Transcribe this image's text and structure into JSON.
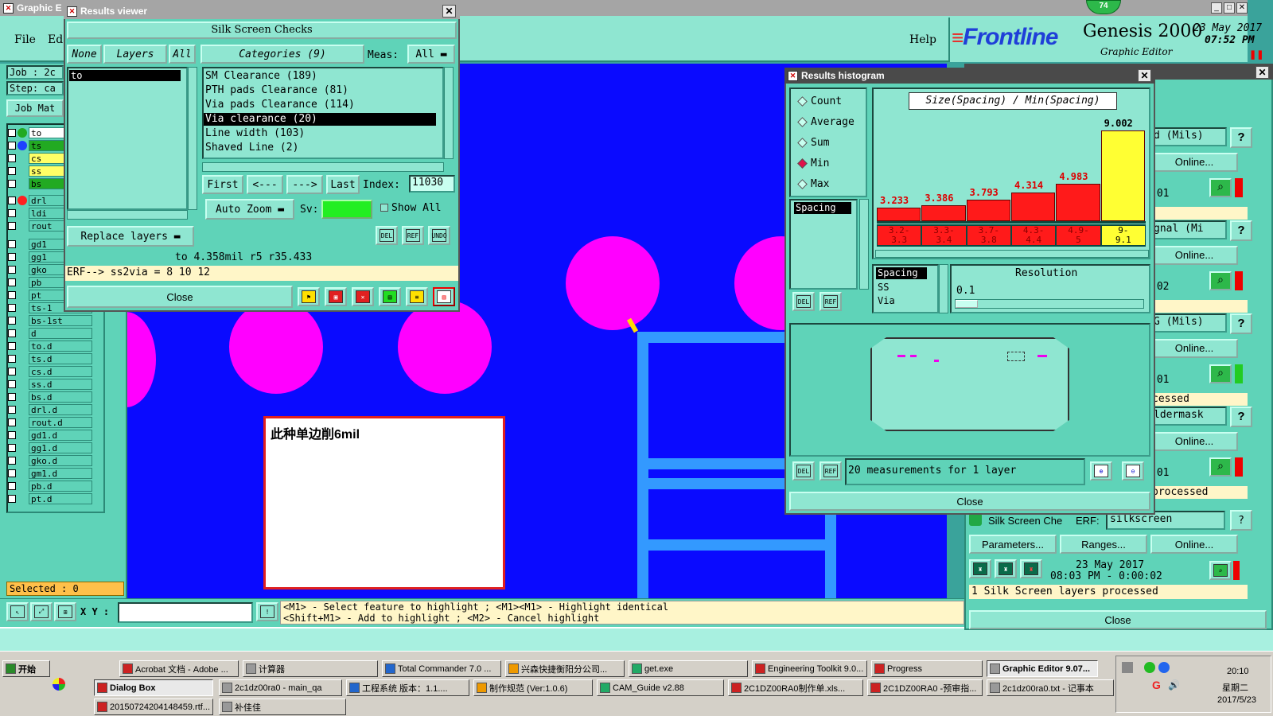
{
  "main_window": {
    "title": "Graphic E",
    "menu": {
      "file": "File",
      "edit": "Ed",
      "help": "Help"
    },
    "brand": {
      "logo": "Frontline",
      "product": "Genesis 2000",
      "subtitle": "Graphic Editor",
      "date": "23 May 2017",
      "time": "07:52 PM"
    },
    "badge": "74",
    "job_label": "Job : 2c",
    "step_label": "Step: ca",
    "job_matrix": "Job Mat",
    "selected": "Selected : 0",
    "coord_label": "X Y :",
    "status_line1": "<M1> - Select feature to highlight ; <M1><M1> - Highlight identical",
    "status_line2": "<Shift+M1> - Add to highlight ; <M2> - Cancel highlight"
  },
  "layers": [
    {
      "name": "to",
      "color": "#2f4fff",
      "dot": "#22aa22",
      "bg": "#ffffff"
    },
    {
      "name": "ts",
      "color": "#2f4fff",
      "dot": "#1e40ff",
      "bg": "#22aa22"
    },
    {
      "name": "cs",
      "color": "#ffff66",
      "dot": "",
      "bg": "#ffff66"
    },
    {
      "name": "ss",
      "color": "#ffff66",
      "dot": "",
      "bg": "#ffff66"
    },
    {
      "name": "bs",
      "color": "#22aa22",
      "dot": "",
      "bg": "#22aa22"
    },
    {
      "name": "drl",
      "color": "",
      "dot": "#ff2020",
      "bg": "#5fd3b8"
    },
    {
      "name": "ldi",
      "color": "",
      "dot": "",
      "bg": "#5fd3b8"
    },
    {
      "name": "rout",
      "color": "",
      "dot": "",
      "bg": "#5fd3b8"
    },
    {
      "name": "gd1",
      "color": "",
      "dot": "",
      "bg": "#5fd3b8"
    },
    {
      "name": "gg1",
      "color": "",
      "dot": "",
      "bg": "#5fd3b8"
    },
    {
      "name": "gko",
      "color": "",
      "dot": "",
      "bg": "#5fd3b8"
    },
    {
      "name": "pb",
      "color": "",
      "dot": "",
      "bg": "#5fd3b8"
    },
    {
      "name": "pt",
      "color": "",
      "dot": "",
      "bg": "#5fd3b8"
    },
    {
      "name": "ts-1",
      "color": "",
      "dot": "",
      "bg": "#5fd3b8"
    },
    {
      "name": "bs-1st",
      "color": "",
      "dot": "",
      "bg": "#5fd3b8"
    },
    {
      "name": "d",
      "color": "",
      "dot": "",
      "bg": "#5fd3b8"
    },
    {
      "name": "to.d",
      "color": "",
      "dot": "",
      "bg": "#5fd3b8"
    },
    {
      "name": "ts.d",
      "color": "",
      "dot": "",
      "bg": "#5fd3b8"
    },
    {
      "name": "cs.d",
      "color": "",
      "dot": "",
      "bg": "#5fd3b8"
    },
    {
      "name": "ss.d",
      "color": "",
      "dot": "",
      "bg": "#5fd3b8"
    },
    {
      "name": "bs.d",
      "color": "",
      "dot": "",
      "bg": "#5fd3b8"
    },
    {
      "name": "drl.d",
      "color": "",
      "dot": "",
      "bg": "#5fd3b8"
    },
    {
      "name": "rout.d",
      "color": "",
      "dot": "",
      "bg": "#5fd3b8"
    },
    {
      "name": "gd1.d",
      "color": "",
      "dot": "",
      "bg": "#5fd3b8"
    },
    {
      "name": "gg1.d",
      "color": "",
      "dot": "",
      "bg": "#5fd3b8"
    },
    {
      "name": "gko.d",
      "color": "",
      "dot": "",
      "bg": "#5fd3b8"
    },
    {
      "name": "gm1.d",
      "color": "",
      "dot": "",
      "bg": "#5fd3b8"
    },
    {
      "name": "pb.d",
      "color": "",
      "dot": "",
      "bg": "#5fd3b8"
    },
    {
      "name": "pt.d",
      "color": "",
      "dot": "",
      "bg": "#5fd3b8"
    }
  ],
  "canvas_note": "此种单边削6mil",
  "results_viewer": {
    "title": "Results viewer",
    "header": "Silk Screen Checks",
    "none_btn": "None",
    "layers_btn": "Layers",
    "all_btn": "All",
    "categories_btn": "Categories (9)",
    "meas_label": "Meas:",
    "meas_value": "All",
    "layer_selected": "to",
    "categories": [
      "SM Clearance (189)",
      "PTH pads Clearance (81)",
      "Via pads Clearance (114)",
      "Via clearance (20)",
      "Line width (103)",
      "Shaved Line (2)"
    ],
    "selected_category_index": 3,
    "nav": {
      "first": "First",
      "prev": "<---",
      "next": "--->",
      "last": "Last",
      "index_label": "Index:",
      "index_value": "11030"
    },
    "auto_zoom": "Auto Zoom",
    "sv_label": "Sv:",
    "show_all": "Show All",
    "replace_layers": "Replace layers",
    "info_line": "to  4.358mil  r5  r35.433",
    "erf_line": "ERF--> ss2via = 8 10 12",
    "close": "Close",
    "del": "DEL",
    "ref": "REF",
    "undo": "UNDO"
  },
  "results_histogram": {
    "title": "Results histogram",
    "modes": [
      "Count",
      "Average",
      "Sum",
      "Min",
      "Max"
    ],
    "selected_mode": "Min",
    "measure_list": [
      "Spacing"
    ],
    "chart_title": "Size(Spacing) / Min(Spacing)",
    "resolution_label": "Resolution",
    "resolution_value": "0.1",
    "types": [
      "Spacing",
      "SS",
      "Via"
    ],
    "summary": "20 measurements for 1 layer",
    "close": "Close",
    "del": "DEL",
    "ref": "REF"
  },
  "chart_data": {
    "type": "bar",
    "title": "Size(Spacing) / Min(Spacing)",
    "categories": [
      "3.2-3.3",
      "3.3-3.4",
      "3.7-3.8",
      "4.3-4.4",
      "4.9-5",
      "9-9.1"
    ],
    "values": [
      3.233,
      3.386,
      3.793,
      4.314,
      4.983,
      9.002
    ],
    "colors": [
      "#ff1a1a",
      "#ff1a1a",
      "#ff1a1a",
      "#ff1a1a",
      "#ff1a1a",
      "#ffff33"
    ],
    "ylim": [
      0,
      9.5
    ]
  },
  "right_panel": {
    "rows": [
      {
        "label": "d (Mils)",
        "online": "Online...",
        "time": ":01",
        "status": "",
        "ok": false
      },
      {
        "label": "gnal (Mi",
        "online": "Online...",
        "time": ":02",
        "status": "",
        "ok": false
      },
      {
        "label": "G (Mils)",
        "online": "Online...",
        "time": ":01",
        "status": "cessed",
        "ok": true
      },
      {
        "label": "ldermask",
        "online": "Online...",
        "time": ":01",
        "status": "processed",
        "ok": false
      }
    ],
    "silk_check": "Silk Screen Che",
    "erf_label": "ERF:",
    "erf_value": "silkscreen",
    "parameters": "Parameters...",
    "ranges": "Ranges...",
    "online": "Online...",
    "run_date": "23 May 2017",
    "run_time": "08:03 PM - 0:00:02",
    "processed": "1 Silk Screen layers processed",
    "close": "Close"
  },
  "taskbar": {
    "start": "开始",
    "row1": [
      "Acrobat 文档 - Adobe ...",
      "计算器",
      "Total Commander 7.0 ...",
      "兴森快捷衡阳分公司...",
      "get.exe",
      "Engineering Toolkit 9.0...",
      "Progress",
      "Graphic Editor 9.07..."
    ],
    "row2": [
      "Dialog Box",
      "2c1dz00ra0 - main_qa",
      "工程系统  版本：1.1....",
      "制作规范 (Ver:1.0.6)",
      "CAM_Guide v2.88",
      "2C1DZ00RA0制作单.xls...",
      "2C1DZ00RA0 -预审指...",
      "2c1dz00ra0.txt - 记事本"
    ],
    "row3": [
      "20150724204148459.rtf...",
      "补佳佳"
    ],
    "clock_time": "20:10",
    "clock_day": "星期二",
    "clock_date": "2017/5/23"
  },
  "colors": {
    "canvas": "#0a0aff",
    "panel": "#5fd3b8",
    "pad": "#ff00ff",
    "trace": "#3399ff"
  }
}
